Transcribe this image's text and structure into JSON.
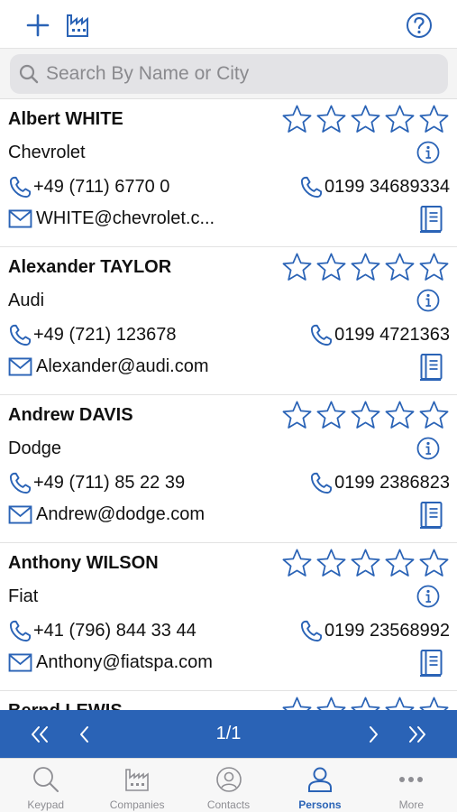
{
  "toolbar": {
    "add_icon": "plus-icon",
    "companies_icon": "factory-icon",
    "help_icon": "help-icon"
  },
  "search": {
    "placeholder": "Search By Name or City",
    "value": ""
  },
  "contacts": [
    {
      "name": "Albert WHITE",
      "company": "Chevrolet",
      "phone": "+49 (711) 6770 0",
      "mobile": "0199 34689334",
      "email": "WHITE@chevrolet.c...",
      "rating": 0
    },
    {
      "name": "Alexander TAYLOR",
      "company": "Audi",
      "phone": "+49 (721) 123678",
      "mobile": "0199 4721363",
      "email": "Alexander@audi.com",
      "rating": 0
    },
    {
      "name": "Andrew DAVIS",
      "company": "Dodge",
      "phone": "+49 (711) 85 22 39",
      "mobile": "0199 2386823",
      "email": "Andrew@dodge.com",
      "rating": 0
    },
    {
      "name": "Anthony WILSON",
      "company": "Fiat",
      "phone": "+41 (796) 844 33 44",
      "mobile": "0199 23568992",
      "email": "Anthony@fiatspa.com",
      "rating": 0
    },
    {
      "name": "Bernd LEWIS",
      "company": "",
      "phone": "",
      "mobile": "",
      "email": "",
      "rating": 0
    }
  ],
  "pager": {
    "page_label": "1/1"
  },
  "tabs": [
    {
      "label": "Keypad",
      "icon": "search-icon",
      "active": false
    },
    {
      "label": "Companies",
      "icon": "factory-icon",
      "active": false
    },
    {
      "label": "Contacts",
      "icon": "contact-icon",
      "active": false
    },
    {
      "label": "Persons",
      "icon": "person-icon",
      "active": true
    },
    {
      "label": "More",
      "icon": "more-icon",
      "active": false
    }
  ],
  "colors": {
    "accent": "#2a63b6",
    "pager_bg": "#2a63b6",
    "inactive": "#8e8e93"
  }
}
